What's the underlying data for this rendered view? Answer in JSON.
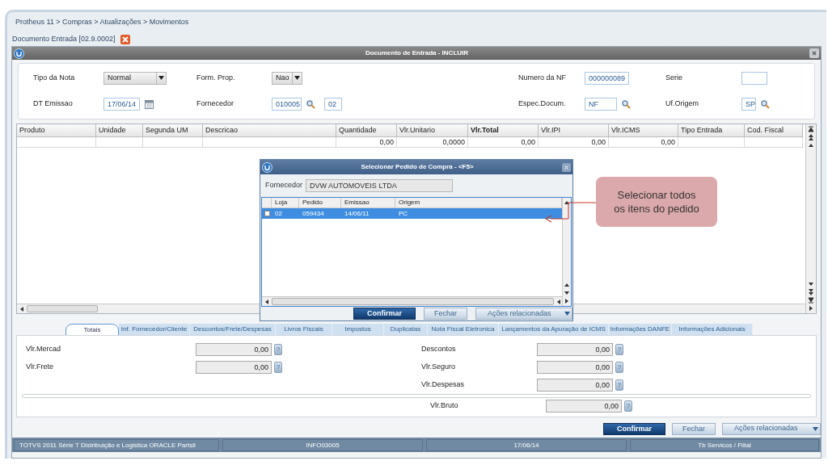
{
  "breadcrumb": "Protheus 11 > Compras  > Atualizações > Movimentos",
  "document_tab": {
    "label": "Documento Entrada [02.9.0002]"
  },
  "window": {
    "title": "Documento de Entrada - INCLUIR"
  },
  "header_fields": [
    {
      "label": "Tipo da Nota",
      "kind": "select",
      "value": "Normal"
    },
    {
      "label": "Form. Prop.",
      "kind": "select",
      "value": "Nao"
    },
    {
      "label": "Numero da NF",
      "kind": "text",
      "value": "000000089"
    },
    {
      "label": "Serie",
      "kind": "text"
    },
    {
      "label": "DT Emissao",
      "kind": "date",
      "value": "17/06/14"
    },
    {
      "label": "Fornecedor",
      "kind": "lookup",
      "value": "010005",
      "extra": "02"
    },
    {
      "label": "Espec.Docum.",
      "kind": "lookup",
      "value": "NF"
    },
    {
      "label": "Uf.Origem",
      "kind": "lookup",
      "value": "SP"
    }
  ],
  "grid": {
    "columns": [
      {
        "label": "Produto",
        "bold": false
      },
      {
        "label": "Unidade",
        "bold": false
      },
      {
        "label": "Segunda UM",
        "bold": false
      },
      {
        "label": "Descricao",
        "bold": false
      },
      {
        "label": "Quantidade",
        "bold": false
      },
      {
        "label": "Vlr.Unitario",
        "bold": false
      },
      {
        "label": "Vlr.Total",
        "bold": true
      },
      {
        "label": "Vlr.IPI",
        "bold": false
      },
      {
        "label": "Vlr.ICMS",
        "bold": false
      },
      {
        "label": "Tipo Entrada",
        "bold": false
      },
      {
        "label": "Cod. Fiscal",
        "bold": false
      }
    ],
    "rows": [
      [
        null,
        null,
        null,
        null,
        "0,00",
        "0,0000",
        "0,00",
        "0,00",
        "0,00",
        null,
        null
      ]
    ]
  },
  "tabs": [
    {
      "label": "Totais",
      "selected": true
    },
    {
      "label": "Inf. Fornecedor/Cliente",
      "selected": false
    },
    {
      "label": "Descontos/Frete/Despesas",
      "selected": false
    },
    {
      "label": "Livros Fiscais",
      "selected": false
    },
    {
      "label": "Impostos",
      "selected": false
    },
    {
      "label": "Duplicatas",
      "selected": false
    },
    {
      "label": "Nota Fiscal Eletronica",
      "selected": false
    },
    {
      "label": "Lançamentos da Apuração de ICMS",
      "selected": false
    },
    {
      "label": "Informações DANFE",
      "selected": false
    },
    {
      "label": "Informações Adicionais",
      "selected": false
    }
  ],
  "totals_left": [
    {
      "label": "Vlr.Mercad",
      "value": "0,00"
    },
    {
      "label": "Vlr.Frete",
      "value": "0,00"
    }
  ],
  "totals_right": [
    {
      "label": "Descontos",
      "value": "0,00"
    },
    {
      "label": "Vlr.Seguro",
      "value": "0,00"
    },
    {
      "label": "Vlr.Despesas",
      "value": "0,00"
    }
  ],
  "totals_total": {
    "label": "Vlr.Bruto",
    "value": "0,00"
  },
  "help_mark": "?",
  "buttons": [
    {
      "label": "Confirmar",
      "kind": "primary"
    },
    {
      "label": "Fechar",
      "kind": "secondary"
    },
    {
      "label": "Ações relacionadas",
      "kind": "menu"
    }
  ],
  "status_bar": [
    "TOTVS 2011 Série T Distribuição e Logistica ORACLE Partsil",
    "INFO03005",
    "17/06/14",
    "Tb Servicos / Filial"
  ],
  "dialog": {
    "title": "Selecionar Pedido de Compra - <F5>",
    "supplier": {
      "label": "Fornecedor",
      "value": "DVW AUTOMOVEIS LTDA"
    },
    "columns": [
      "Loja",
      "Pedido",
      "Emissao",
      "Origem"
    ],
    "rows": [
      {
        "checked": false,
        "selected": true,
        "cells": [
          "02",
          "059434",
          "14/06/11",
          "PC"
        ]
      }
    ],
    "buttons": [
      {
        "label": "Confirmar",
        "kind": "primary"
      },
      {
        "label": "Fechar",
        "kind": "secondary"
      },
      {
        "label": "Ações relacionadas",
        "kind": "menu"
      }
    ]
  },
  "callout": {
    "text": "Selecionar todos os itens do pedido"
  }
}
